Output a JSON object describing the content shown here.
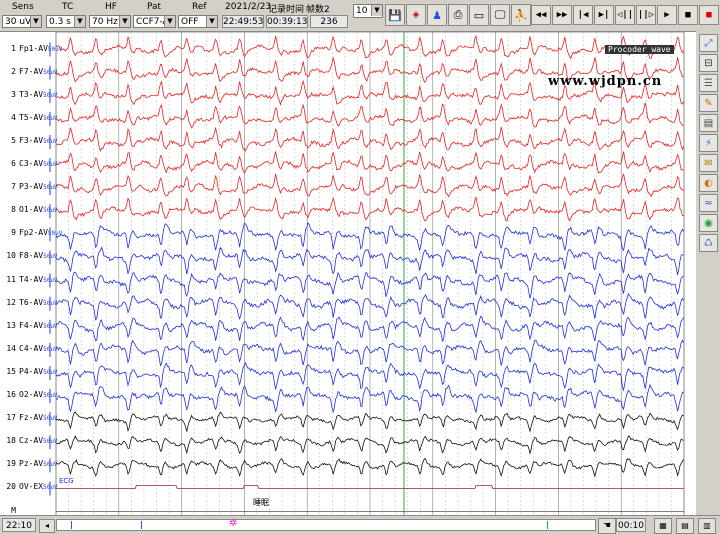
{
  "toolbar": {
    "labels": {
      "sens": "Sens",
      "tc": "TC",
      "hf": "HF",
      "pat": "Pat",
      "ref": "Ref",
      "date": "2021/2/23",
      "record_time": "记录时间",
      "frame_count": "帧数2"
    },
    "sens_value": "30 uV",
    "tc_value": "0.3 s",
    "hf_value": "70 Hz",
    "pat_value": "CCF7-AV",
    "ref_value": "OFF",
    "clock": "22:49:53",
    "elapsed": "00:39:13",
    "frames": "236",
    "page_span": "10 s",
    "tool_icons": [
      "floppy-disk-icon",
      "calendar-icon",
      "person-icon",
      "printer-icon",
      "screen-capture-icon",
      "run-icon"
    ],
    "nav_buttons": [
      {
        "glyph": "◀◀",
        "name": "fast-rewind"
      },
      {
        "glyph": "▶▶",
        "name": "fast-forward"
      },
      {
        "glyph": "|◀",
        "name": "go-start"
      },
      {
        "glyph": "▶|",
        "name": "go-end"
      },
      {
        "glyph": "◁||",
        "name": "step-back"
      },
      {
        "glyph": "||▷",
        "name": "step-forward"
      },
      {
        "glyph": "▶",
        "name": "play"
      },
      {
        "glyph": "■",
        "name": "stop"
      },
      {
        "glyph": "■",
        "name": "stop-red"
      }
    ]
  },
  "overlay": {
    "procoder": "Procoder wave",
    "watermark": "www.wjdpn.cn"
  },
  "channels": [
    {
      "num": "1",
      "name": "Fp1-AV",
      "color": "#e8231e"
    },
    {
      "num": "2",
      "name": "F7-AV",
      "color": "#e8231e"
    },
    {
      "num": "3",
      "name": "T3-AV",
      "color": "#e8231e"
    },
    {
      "num": "4",
      "name": "T5-AV",
      "color": "#e8231e"
    },
    {
      "num": "5",
      "name": "F3-AV",
      "color": "#e8231e"
    },
    {
      "num": "6",
      "name": "C3-AV",
      "color": "#e8231e"
    },
    {
      "num": "7",
      "name": "P3-AV",
      "color": "#e8231e"
    },
    {
      "num": "8",
      "name": "O1-AV",
      "color": "#e8231e"
    },
    {
      "num": "9",
      "name": "Fp2-AV",
      "color": "#1f2fe0"
    },
    {
      "num": "10",
      "name": "F8-AV",
      "color": "#1f2fe0"
    },
    {
      "num": "11",
      "name": "T4-AV",
      "color": "#1f2fe0"
    },
    {
      "num": "12",
      "name": "T6-AV",
      "color": "#1f2fe0"
    },
    {
      "num": "13",
      "name": "F4-AV",
      "color": "#1f2fe0"
    },
    {
      "num": "14",
      "name": "C4-AV",
      "color": "#1f2fe0"
    },
    {
      "num": "15",
      "name": "P4-AV",
      "color": "#1f2fe0"
    },
    {
      "num": "16",
      "name": "O2-AV",
      "color": "#1f2fe0"
    },
    {
      "num": "17",
      "name": "Fz-AV",
      "color": "#111111"
    },
    {
      "num": "18",
      "name": "Cz-AV",
      "color": "#111111"
    },
    {
      "num": "19",
      "name": "Pz-AV",
      "color": "#111111"
    },
    {
      "num": "20",
      "name": "OV-EX",
      "color": "#a0203a"
    },
    {
      "num": "M",
      "name": "",
      "color": "#555555"
    }
  ],
  "ref_suffix": "50uV",
  "ecg_label": "ECG",
  "annotation": "睡眠",
  "right_tools": [
    "zoom-in-icon",
    "zoom-out-icon",
    "montage-icon",
    "filter-icon",
    "measure-icon",
    "spike-icon",
    "note-icon",
    "map-icon",
    "spectrum-icon",
    "topo-icon",
    "video-icon"
  ],
  "status": {
    "left_time": "22:10",
    "right_time": "00:10"
  }
}
